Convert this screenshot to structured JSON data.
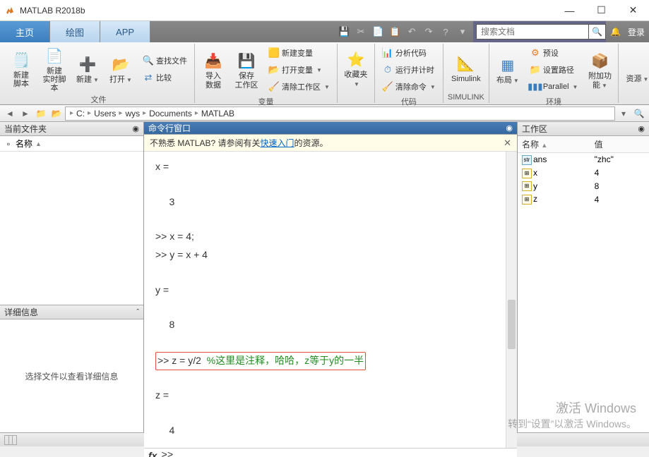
{
  "app": {
    "title": "MATLAB R2018b"
  },
  "winbtns": {
    "min": "—",
    "max": "☐",
    "close": "✕"
  },
  "tabs": [
    {
      "label": "主页",
      "active": true
    },
    {
      "label": "绘图",
      "active": false
    },
    {
      "label": "APP",
      "active": false
    }
  ],
  "quick": [
    "cut-icon",
    "copy-icon",
    "paste-icon",
    "undo-icon",
    "redo-icon",
    "switch-icon",
    "help-icon",
    "dd-icon"
  ],
  "search": {
    "placeholder": "搜索文档"
  },
  "rightbar": {
    "login": "登录"
  },
  "toolstrip": {
    "file": {
      "new_script": "新建\n脚本",
      "new_live": "新建\n实时脚本",
      "new": "新建",
      "open": "打开",
      "findfiles": "查找文件",
      "compare": "比较",
      "caption": "文件"
    },
    "var": {
      "import": "导入\n数据",
      "save_ws": "保存\n工作区",
      "new_var": "新建变量",
      "open_var": "打开变量",
      "clear_ws": "清除工作区",
      "caption": "变量"
    },
    "fav": {
      "fav": "收藏夹"
    },
    "code": {
      "analyze": "分析代码",
      "runtimer": "运行并计时",
      "clearcmd": "清除命令",
      "caption": "代码"
    },
    "simulink": {
      "simulink": "Simulink",
      "caption": "SIMULINK"
    },
    "env": {
      "layout": "布局",
      "prefs": "预设",
      "setpath": "设置路径",
      "parallel": "Parallel",
      "addons": "附加功能",
      "caption": "环境"
    },
    "res": {
      "res": "资源"
    }
  },
  "path": {
    "items": [
      "C:",
      "Users",
      "wys",
      "Documents",
      "MATLAB"
    ]
  },
  "currfolder": {
    "title": "当前文件夹",
    "col_name": "名称"
  },
  "details": {
    "title": "详细信息",
    "empty": "选择文件以查看详细信息"
  },
  "cmdwin": {
    "title": "命令行窗口",
    "banner_pre": "不熟悉 MATLAB? 请参阅有关",
    "banner_link": "快速入门",
    "banner_post": "的资源。",
    "lines": {
      "l1": "x =",
      "l2": "     3",
      "l3": ">> x = 4;",
      "l4": ">> y = x + 4",
      "l5": "y =",
      "l6": "     8",
      "l7_code": ">> z = y/2  ",
      "l7_comment": "%这里是注释，哈哈，z等于y的一半",
      "l8": "z =",
      "l9": "     4"
    },
    "prompt": ">>",
    "fx": "fx"
  },
  "workspace": {
    "title": "工作区",
    "col_name": "名称",
    "col_value": "值",
    "vars": [
      {
        "name": "ans",
        "value": "\"zhc\"",
        "type": "str"
      },
      {
        "name": "x",
        "value": "4",
        "type": "num"
      },
      {
        "name": "y",
        "value": "8",
        "type": "num"
      },
      {
        "name": "z",
        "value": "4",
        "type": "num"
      }
    ]
  },
  "watermark": {
    "l1": "激活 Windows",
    "l2": "转到“设置”以激活 Windows。"
  }
}
